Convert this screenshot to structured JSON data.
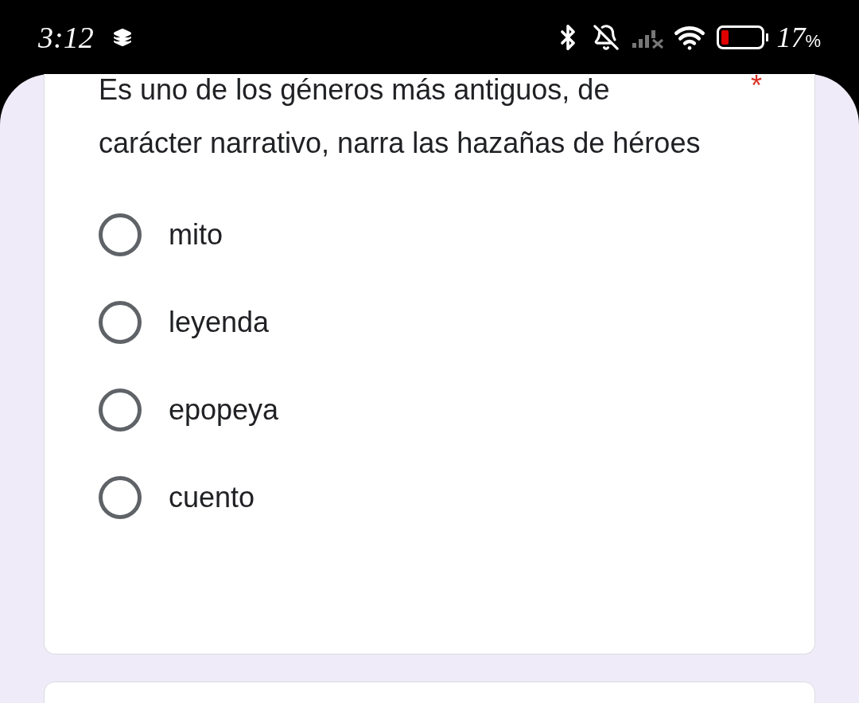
{
  "status_bar": {
    "time": "3:12",
    "level": 0.17,
    "battery_text": "17",
    "battery_unit": "%"
  },
  "question": {
    "text": "Es uno de los géneros más antiguos, de carácter narrativo, narra las hazañas de héroes",
    "required_mark": "*",
    "options": [
      {
        "label": "mito",
        "selected": false
      },
      {
        "label": "leyenda",
        "selected": false
      },
      {
        "label": "epopeya",
        "selected": false
      },
      {
        "label": "cuento",
        "selected": false
      }
    ]
  }
}
